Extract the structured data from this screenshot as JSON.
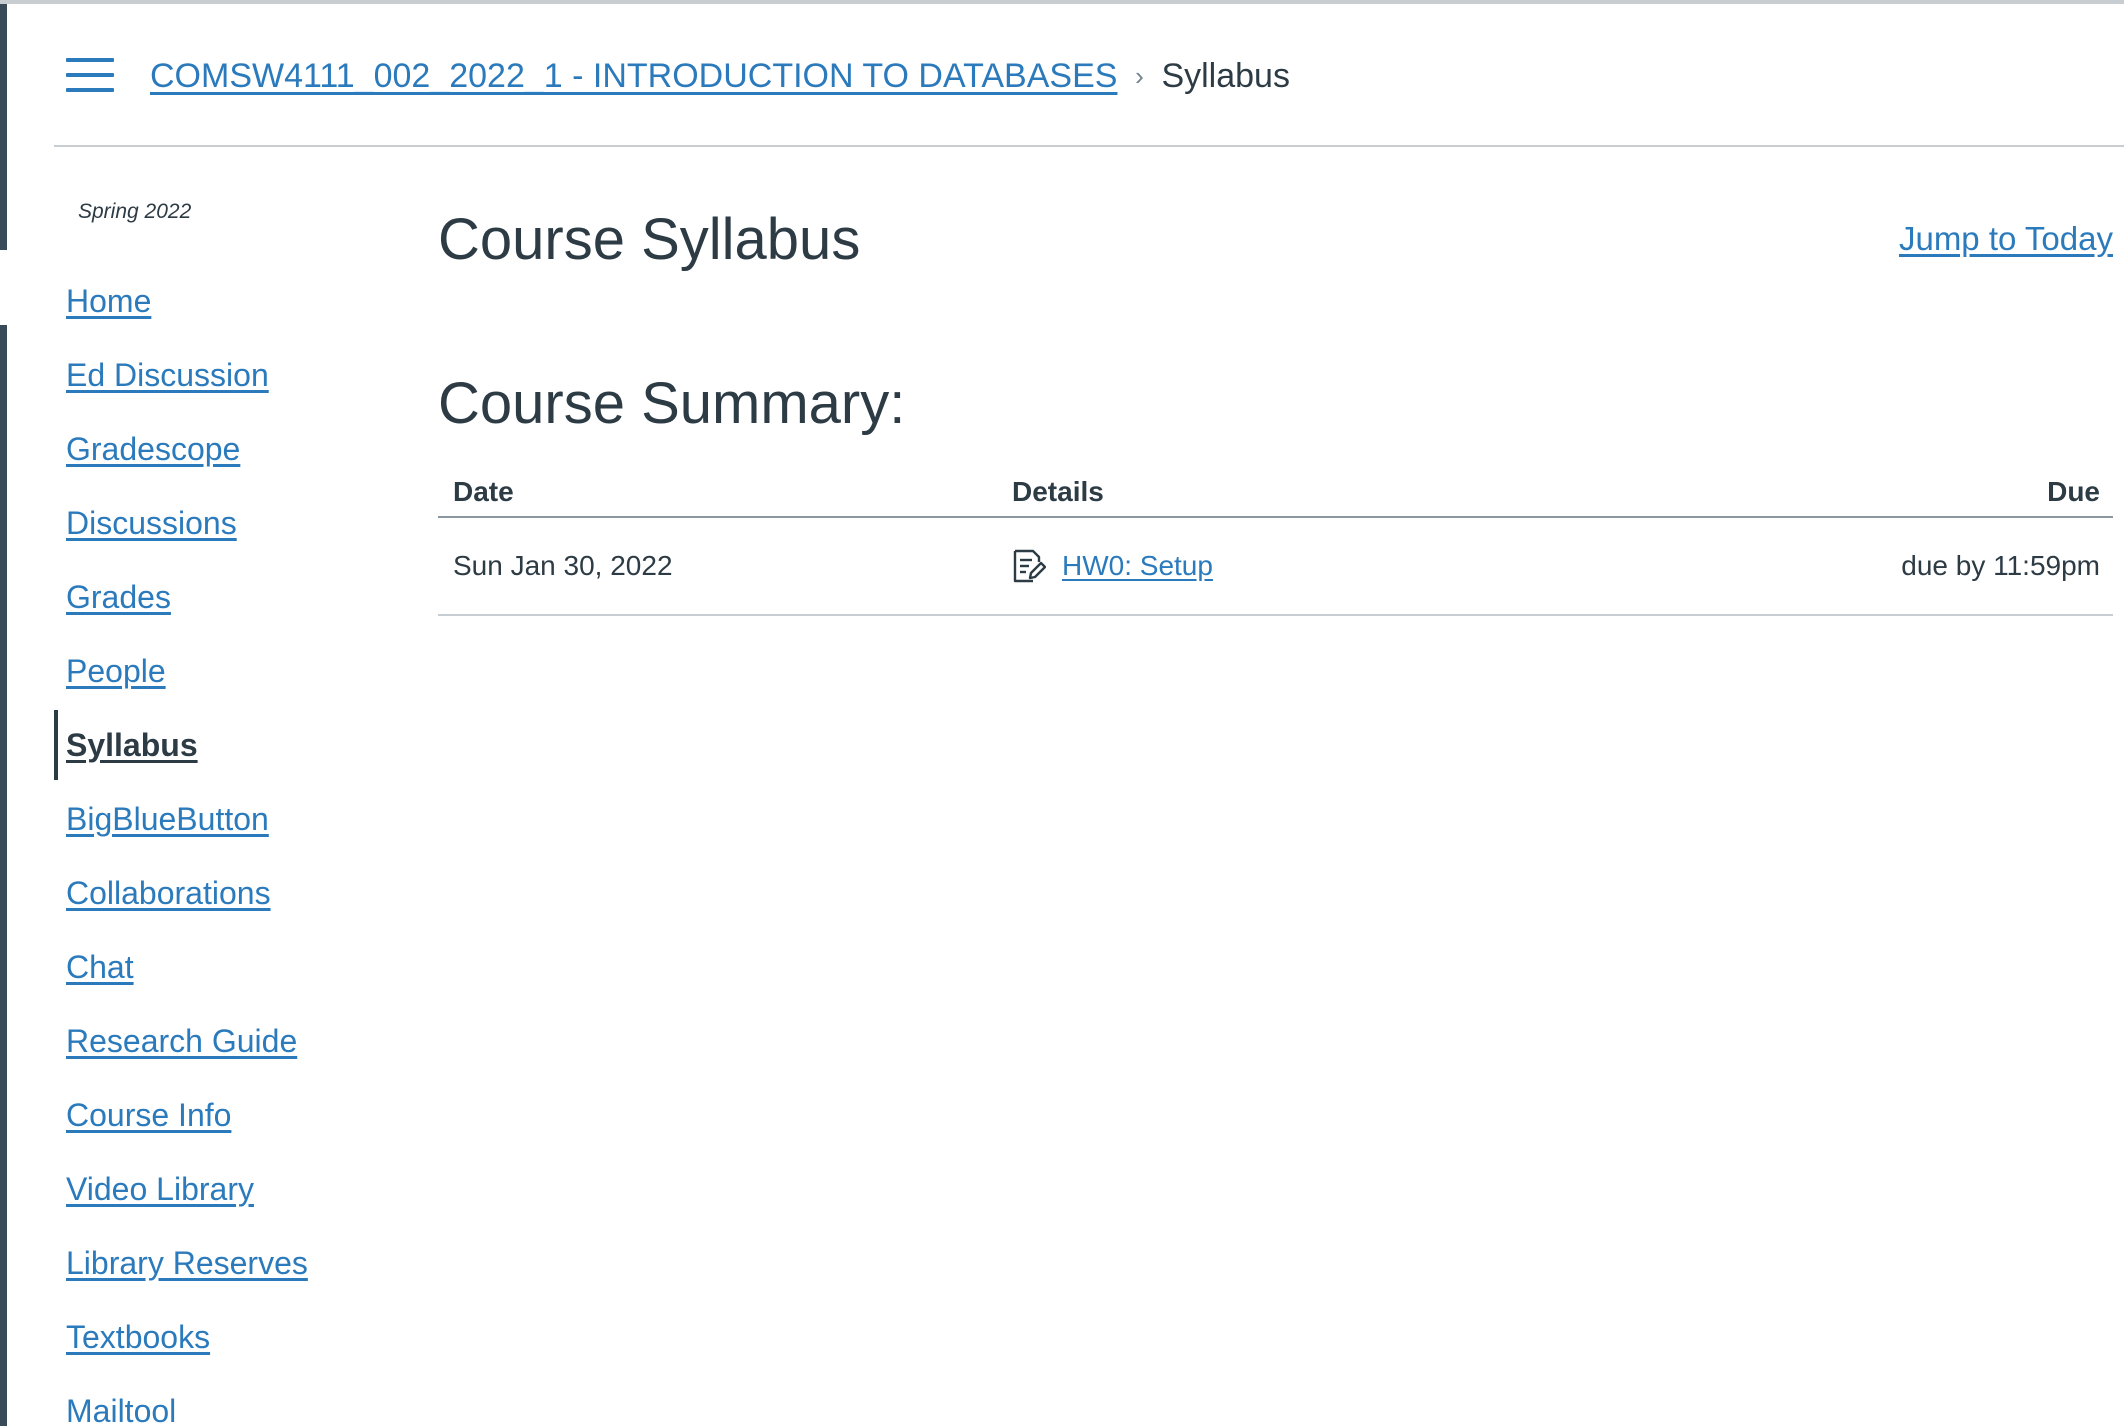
{
  "header": {
    "menu_icon": "hamburger-icon",
    "course_link": "COMSW4111_002_2022_1 - INTRODUCTION TO DATABASES",
    "separator_icon": "chevron-right-icon",
    "current": "Syllabus"
  },
  "sidebar": {
    "term": "Spring 2022",
    "items": [
      {
        "label": "Home"
      },
      {
        "label": "Ed Discussion"
      },
      {
        "label": "Gradescope"
      },
      {
        "label": "Discussions"
      },
      {
        "label": "Grades"
      },
      {
        "label": "People"
      },
      {
        "label": "Syllabus",
        "active": true
      },
      {
        "label": "BigBlueButton"
      },
      {
        "label": "Collaborations"
      },
      {
        "label": "Chat"
      },
      {
        "label": "Research Guide"
      },
      {
        "label": "Course Info"
      },
      {
        "label": "Video Library"
      },
      {
        "label": "Library Reserves"
      },
      {
        "label": "Textbooks"
      },
      {
        "label": "Mailtool"
      }
    ]
  },
  "main": {
    "title": "Course Syllabus",
    "jump_link": "Jump to Today",
    "summary_title": "Course Summary:",
    "table": {
      "headers": {
        "date": "Date",
        "details": "Details",
        "due": "Due"
      },
      "rows": [
        {
          "date": "Sun Jan 30, 2022",
          "icon": "assignment-icon",
          "details": "HW0: Setup",
          "due": "due by 11:59pm"
        }
      ]
    }
  },
  "colors": {
    "link": "#2b7abc",
    "text": "#2d3b45",
    "rail": "#394b58",
    "divider": "#c7cdd1"
  }
}
